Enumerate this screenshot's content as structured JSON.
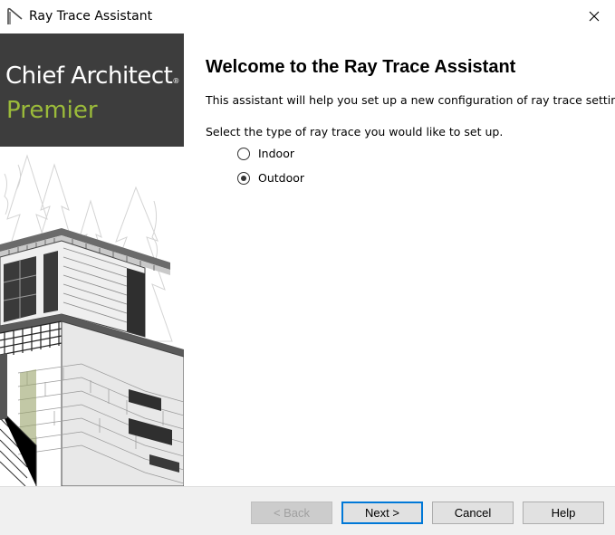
{
  "window": {
    "title": "Ray Trace Assistant",
    "icon": "chief-architect-logo-icon",
    "close_icon": "close-icon"
  },
  "brand": {
    "line1": "Chief Architect",
    "registered": "®",
    "line2": "Premier",
    "colors": {
      "background": "#3d3d3d",
      "line1": "#ffffff",
      "line2": "#9bbb3a"
    }
  },
  "content": {
    "heading": "Welcome to the Ray Trace Assistant",
    "intro": "This assistant will help you set up a new configuration of ray trace settings.",
    "prompt": "Select the type of ray trace you would like to set up.",
    "options": [
      {
        "label": "Indoor",
        "checked": false
      },
      {
        "label": "Outdoor",
        "checked": true
      }
    ]
  },
  "buttons": {
    "back": "< Back",
    "next": "Next >",
    "cancel": "Cancel",
    "help": "Help"
  },
  "colors": {
    "default_button_border": "#0078d7",
    "footer_background": "#f0f0f0"
  }
}
